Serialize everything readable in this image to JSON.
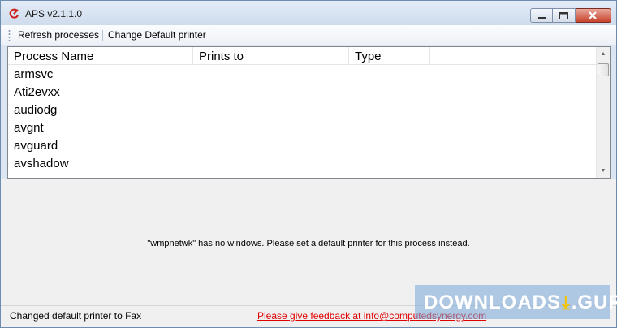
{
  "window": {
    "title": "APS v2.1.1.0",
    "icon": "aps-logo-icon"
  },
  "toolbar": {
    "refresh_label": "Refresh processes",
    "change_default_label": "Change Default printer"
  },
  "listview": {
    "columns": [
      "Process Name",
      "Prints to",
      "Type",
      ""
    ],
    "rows": [
      {
        "process": "armsvc",
        "prints_to": "",
        "type": ""
      },
      {
        "process": "Ati2evxx",
        "prints_to": "",
        "type": ""
      },
      {
        "process": "audiodg",
        "prints_to": "",
        "type": ""
      },
      {
        "process": "avgnt",
        "prints_to": "",
        "type": ""
      },
      {
        "process": "avguard",
        "prints_to": "",
        "type": ""
      },
      {
        "process": "avshadow",
        "prints_to": "",
        "type": ""
      }
    ]
  },
  "content": {
    "message": "\"wmpnetwk\" has no windows. Please set a default printer for this process instead."
  },
  "status": {
    "text": "Changed default printer to Fax",
    "feedback": "Please give feedback at info@computedsynergy.com"
  },
  "watermark": {
    "left": "DOWNLOADS",
    "right": ".GURU"
  },
  "colors": {
    "link": "#e00000",
    "close_button": "#c8432d",
    "content_bg": "#f0f0f0"
  }
}
